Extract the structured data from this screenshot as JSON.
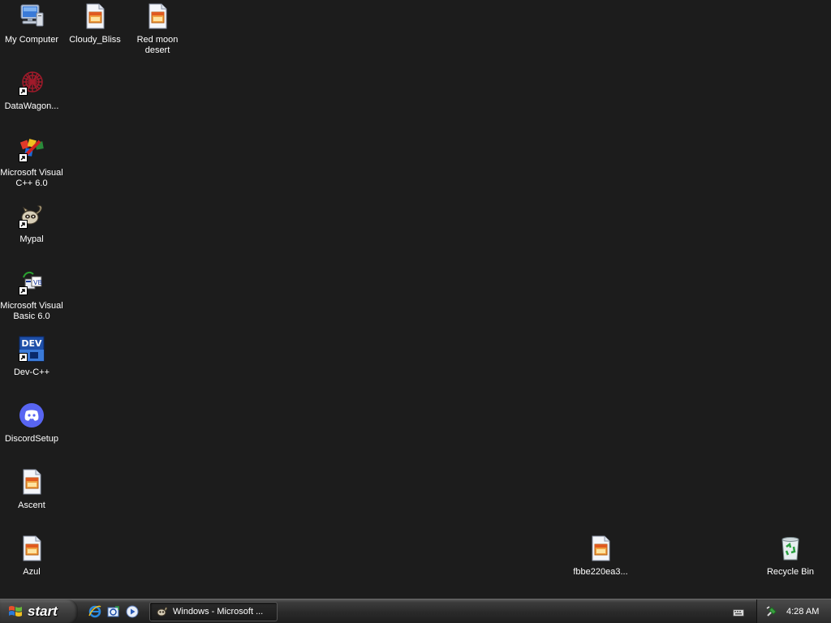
{
  "desktop": {
    "icons": [
      {
        "label": "My Computer",
        "icon": "my-computer-icon"
      },
      {
        "label": "Cloudy_Bliss",
        "icon": "image-file-icon"
      },
      {
        "label": "Red moon desert",
        "icon": "image-file-icon"
      },
      {
        "label": "DataWagon...",
        "icon": "datawagon-icon"
      },
      {
        "label": "Microsoft Visual C++ 6.0",
        "icon": "visual-cpp-icon"
      },
      {
        "label": "Mypal",
        "icon": "mypal-icon"
      },
      {
        "label": "Microsoft Visual Basic 6.0",
        "icon": "visual-basic-icon"
      },
      {
        "label": "Dev-C++",
        "icon": "dev-cpp-icon",
        "badge": "DEV"
      },
      {
        "label": "DiscordSetup",
        "icon": "discord-icon"
      },
      {
        "label": "Ascent",
        "icon": "image-file-icon"
      },
      {
        "label": "Azul",
        "icon": "image-file-icon"
      },
      {
        "label": "fbbe220ea3...",
        "icon": "image-file-icon"
      },
      {
        "label": "Recycle Bin",
        "icon": "recycle-bin-icon"
      }
    ]
  },
  "taskbar": {
    "start_label": "start",
    "quick_launch": [
      "internet-explorer-icon",
      "outlook-express-icon",
      "media-player-icon"
    ],
    "task_button_label": "Windows - Microsoft ...",
    "clock": "4:28 AM"
  },
  "colors": {
    "desktop_bg": "#1c1c1c",
    "discord": "#5865f2",
    "dev_badge": "#1e4fa8"
  }
}
